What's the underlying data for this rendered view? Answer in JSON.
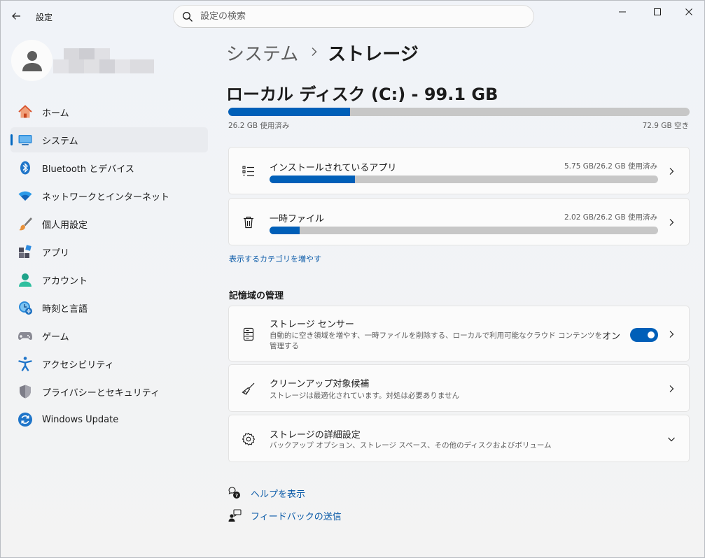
{
  "app": {
    "title": "設定"
  },
  "search": {
    "placeholder": "設定の検索"
  },
  "profile": {
    "name": ""
  },
  "sidebar": {
    "items": [
      {
        "label": "ホーム",
        "icon": "home-icon"
      },
      {
        "label": "システム",
        "icon": "system-icon",
        "active": true
      },
      {
        "label": "Bluetooth とデバイス",
        "icon": "bluetooth-icon"
      },
      {
        "label": "ネットワークとインターネット",
        "icon": "wifi-icon"
      },
      {
        "label": "個人用設定",
        "icon": "brush-icon"
      },
      {
        "label": "アプリ",
        "icon": "apps-icon"
      },
      {
        "label": "アカウント",
        "icon": "account-icon"
      },
      {
        "label": "時刻と言語",
        "icon": "time-language-icon"
      },
      {
        "label": "ゲーム",
        "icon": "gamepad-icon"
      },
      {
        "label": "アクセシビリティ",
        "icon": "accessibility-icon"
      },
      {
        "label": "プライバシーとセキュリティ",
        "icon": "shield-icon"
      },
      {
        "label": "Windows Update",
        "icon": "update-icon"
      }
    ]
  },
  "breadcrumb": {
    "parent": "システム",
    "current": "ストレージ"
  },
  "disk": {
    "title": "ローカル ディスク (C:) - 99.1 GB",
    "used_label": "26.2 GB 使用済み",
    "free_label": "72.9 GB 空き",
    "used_fraction": 0.264
  },
  "categories": [
    {
      "title": "インストールされているアプリ",
      "meta": "5.75 GB/26.2 GB 使用済み",
      "fraction": 0.22,
      "icon": "list-icon"
    },
    {
      "title": "一時ファイル",
      "meta": "2.02 GB/26.2 GB 使用済み",
      "fraction": 0.077,
      "icon": "trash-icon"
    }
  ],
  "more_categories_link": "表示するカテゴリを増やす",
  "management": {
    "section_title": "記憶域の管理",
    "storage_sense": {
      "title": "ストレージ センサー",
      "subtitle_line1": "自動的に空き領域を増やす、一時ファイルを削除する、ローカルで利用可能なクラウド コンテンツを",
      "subtitle_line2": "管理する",
      "toggle_label": "オン",
      "toggle_on": true
    },
    "cleanup": {
      "title": "クリーンアップ対象候補",
      "subtitle": "ストレージは最適化されています。対処は必要ありません"
    },
    "advanced": {
      "title": "ストレージの詳細設定",
      "subtitle": "バックアップ オプション、ストレージ スペース、その他のディスクおよびボリューム"
    }
  },
  "footer": {
    "help": "ヘルプを表示",
    "feedback": "フィードバックの送信"
  },
  "colors": {
    "accent": "#005fb8",
    "link": "#0a5aa8",
    "track": "#c7c7c7"
  }
}
